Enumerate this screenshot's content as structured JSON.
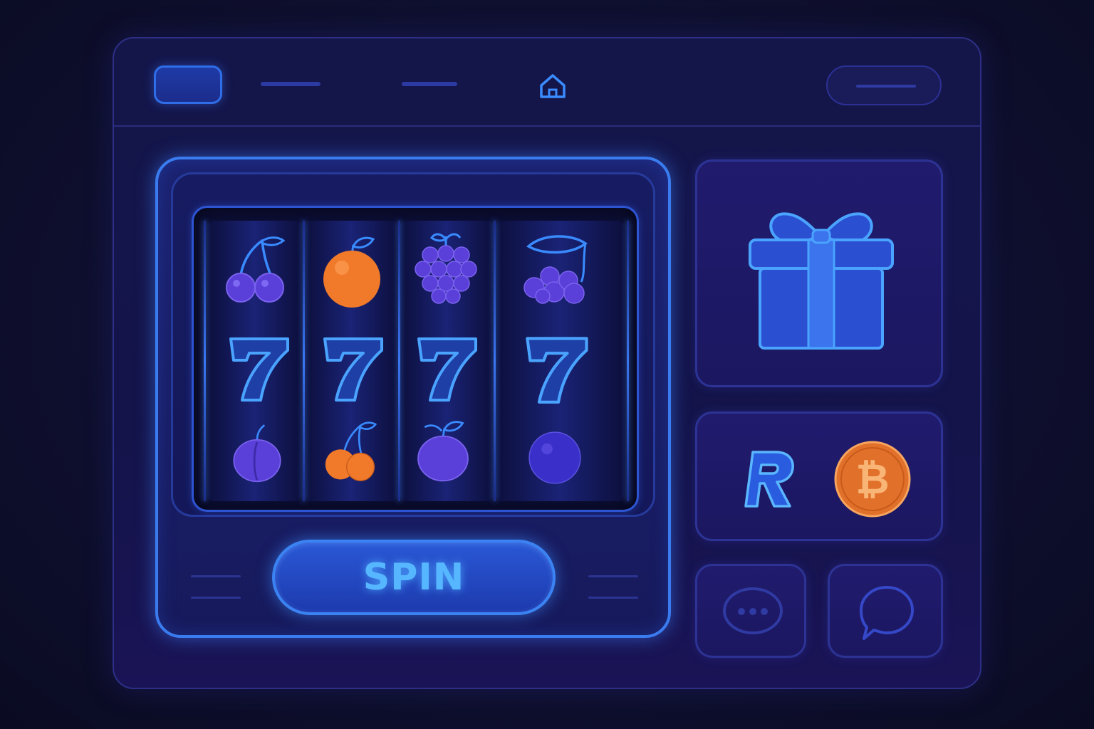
{
  "header": {
    "menu_icon": "menu-icon",
    "home_icon": "home-icon",
    "nav_links": [
      "",
      ""
    ],
    "account_label": ""
  },
  "slot_machine": {
    "reels": [
      [
        "cherries",
        "seven",
        "plum"
      ],
      [
        "orange",
        "seven",
        "orange-cherries"
      ],
      [
        "grapes",
        "seven",
        "plum"
      ],
      [
        "cherries-grapes",
        "seven",
        "berry"
      ]
    ],
    "spin_label": "SPIN"
  },
  "bonus": {
    "icon": "gift-icon"
  },
  "payments": {
    "icons": [
      "revolut-icon",
      "bitcoin-icon"
    ]
  },
  "support": {
    "icons": [
      "chat-icon",
      "support-chat-icon"
    ]
  },
  "colors": {
    "accent": "#3a7cf0",
    "glow": "#56b6ff",
    "purple_fruit": "#5a3fd8",
    "orange_fruit": "#f07a2a",
    "background": "#0f1030"
  }
}
